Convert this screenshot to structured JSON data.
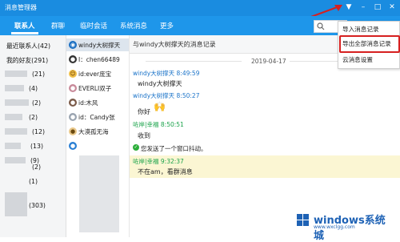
{
  "window": {
    "title": "消息管理器",
    "min": "–",
    "max": "□",
    "close": "✕"
  },
  "tabs": [
    "联系人",
    "群聊",
    "临时会话",
    "系统消息",
    "更多"
  ],
  "groups": [
    {
      "label": "最近联系人(42)"
    },
    {
      "label": "我的好友(291)"
    },
    {
      "label": "(21)"
    },
    {
      "label": "(4)"
    },
    {
      "label": "(2)"
    },
    {
      "label": "(2)"
    },
    {
      "label": "(12)"
    },
    {
      "label": "(13)"
    },
    {
      "label": "(9)"
    },
    {
      "label": "(2)"
    },
    {
      "label": "(1)"
    },
    {
      "label": "(303)"
    }
  ],
  "contacts": [
    {
      "name": "windy大树撑天",
      "selected": true
    },
    {
      "name": "I：chen66489"
    },
    {
      "name": "id:ever庞宝"
    },
    {
      "name": "EVERLI双子"
    },
    {
      "name": "id:木风"
    },
    {
      "name": "id：Candy张"
    },
    {
      "name": "大漠孤无海"
    },
    {
      "name": ""
    }
  ],
  "chat": {
    "header": "与windy大树撑天的消息记录",
    "date": "2019-04-17",
    "messages": [
      {
        "sender": "windy大树撑天 8:49:59",
        "text": "windy大树撑天"
      },
      {
        "sender": "windy大树撑天 8:50:27",
        "text": "你好"
      },
      {
        "sender": "咗岸|幸福 8:50:51",
        "text": "收到"
      },
      {
        "sender": "",
        "text": "您发送了一个窗口抖动。"
      },
      {
        "sender": "咗岸|幸福 9:32:37",
        "text": "不在am，看群消息"
      }
    ]
  },
  "menu": {
    "items": [
      "导入消息记录",
      "导出全部消息记录",
      "云消息设置"
    ]
  },
  "watermark": {
    "brand": "windows系统城",
    "url": "www.wxclgg.com"
  },
  "colors": {
    "titlebar": "#1a8ce0",
    "tabbar": "#1e96ea",
    "highlight": "#d62020"
  }
}
